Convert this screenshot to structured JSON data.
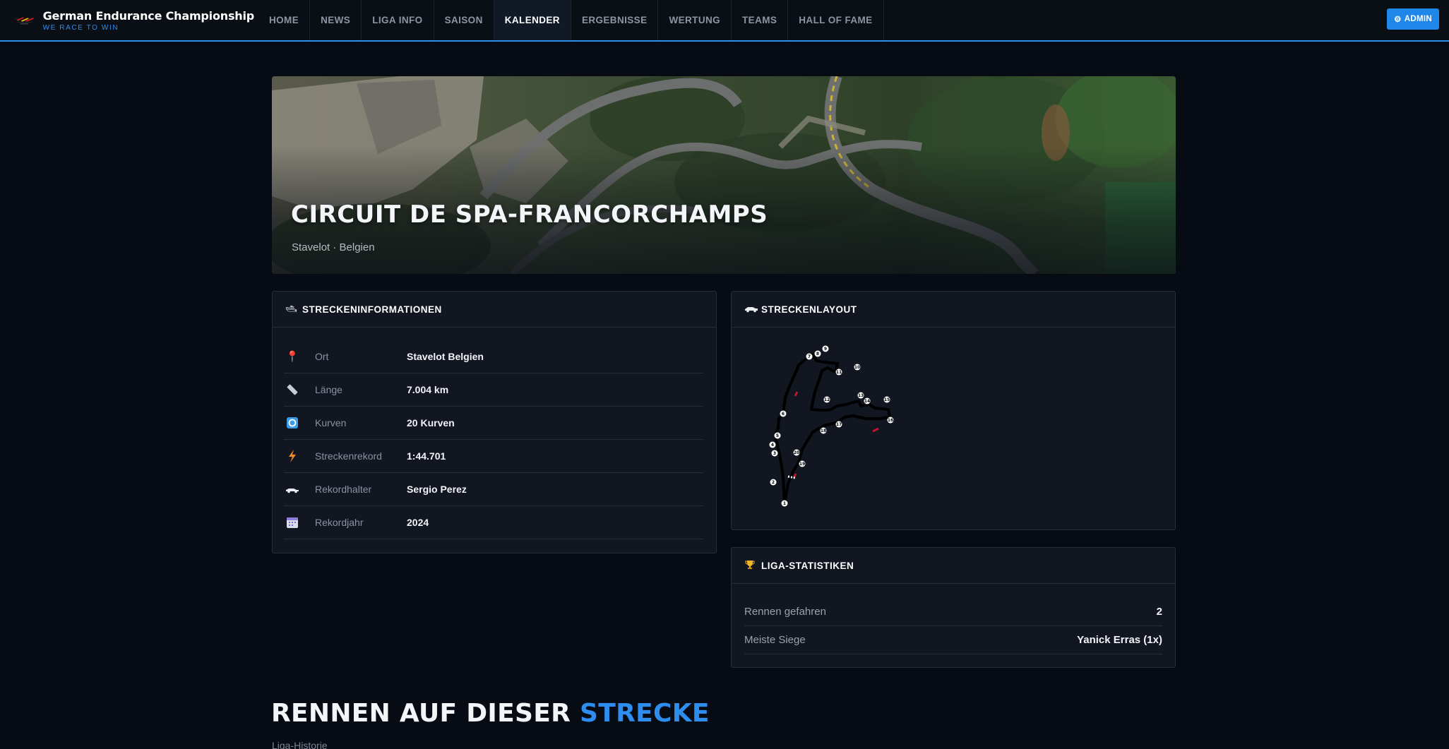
{
  "brand": {
    "title": "German Endurance Championship",
    "tagline": "WE RACE TO WIN"
  },
  "nav": {
    "items": [
      "HOME",
      "NEWS",
      "LIGA INFO",
      "SAISON",
      "KALENDER",
      "ERGEBNISSE",
      "WERTUNG",
      "TEAMS",
      "HALL OF FAME"
    ],
    "active": "KALENDER",
    "admin_label": "ADMIN",
    "admin_icon": "gear-icon"
  },
  "hero": {
    "title": "CIRCUIT DE SPA-FRANCORCHAMPS",
    "subtitle": "Stavelot · Belgien"
  },
  "track_info": {
    "title": "STRECKENINFORMATIONEN",
    "icon": "car-icon",
    "rows": [
      {
        "icon": "pin-icon",
        "label": "Ort",
        "value": "Stavelot Belgien"
      },
      {
        "icon": "ruler-icon",
        "label": "Länge",
        "value": "7.004 km"
      },
      {
        "icon": "refresh-icon",
        "label": "Kurven",
        "value": "20 Kurven"
      },
      {
        "icon": "lightning-icon",
        "label": "Streckenrekord",
        "value": "1:44.701"
      },
      {
        "icon": "racecar-icon",
        "label": "Rekordhalter",
        "value": "Sergio Perez"
      },
      {
        "icon": "calendar-icon",
        "label": "Rekordjahr",
        "value": "2024"
      }
    ]
  },
  "track_layout": {
    "title": "STRECKENLAYOUT",
    "icon": "racecar-icon",
    "corner_numbers": [
      "1",
      "2",
      "3",
      "4",
      "5",
      "6",
      "7",
      "8",
      "9",
      "10",
      "11",
      "12",
      "13",
      "14",
      "15",
      "16",
      "17",
      "18",
      "19",
      "20"
    ]
  },
  "league_stats": {
    "title": "LIGA-STATISTIKEN",
    "icon": "trophy-icon",
    "rows": [
      {
        "label": "Rennen gefahren",
        "value": "2"
      },
      {
        "label": "Meiste Siege",
        "value": "Yanick Erras (1x)"
      }
    ]
  },
  "races_section": {
    "title_main": "RENNEN AUF DIESER ",
    "title_accent": "STRECKE",
    "subtitle": "Liga-Historie"
  },
  "colors": {
    "accent": "#2d8ef0",
    "background": "#070b14",
    "card": "#111621"
  }
}
